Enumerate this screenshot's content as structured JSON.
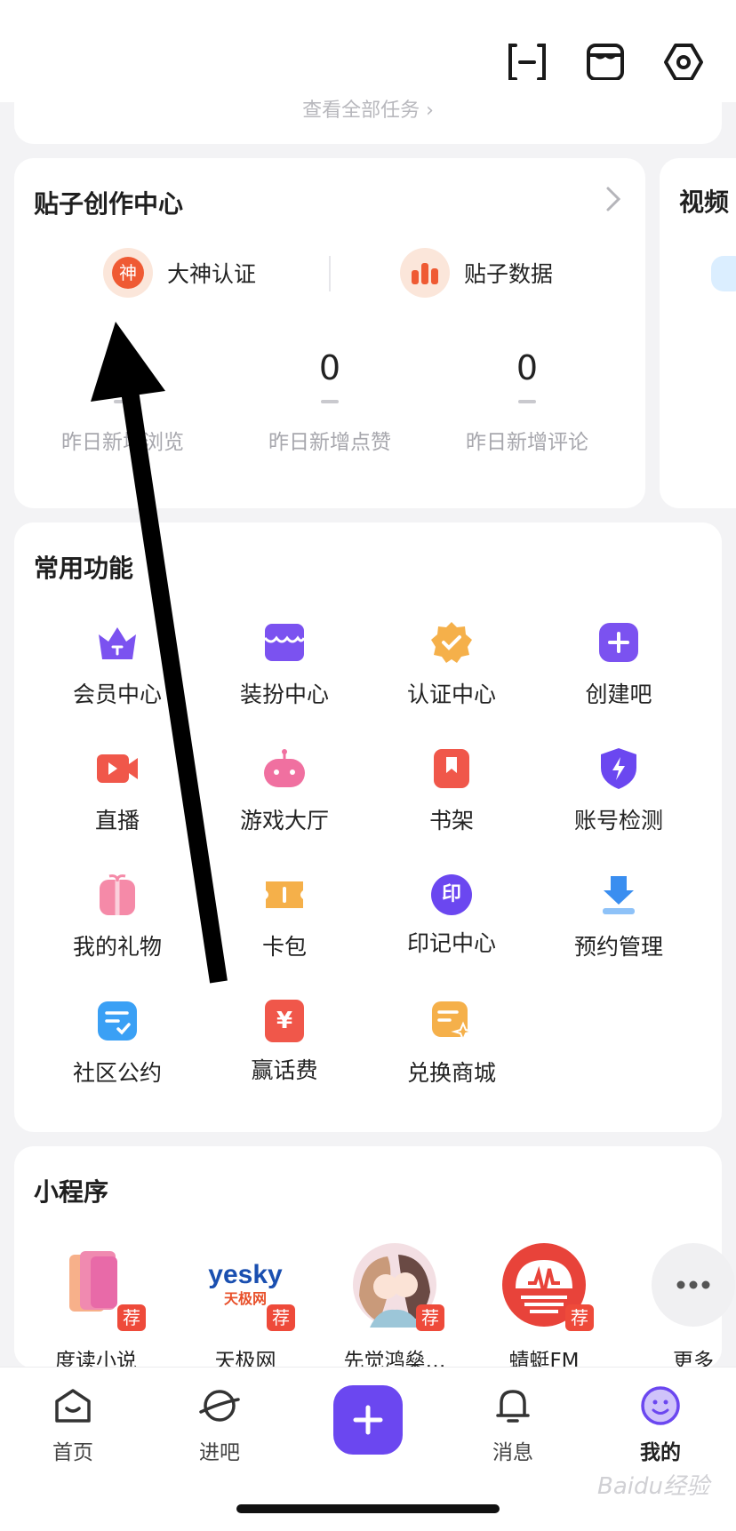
{
  "top_actions": {
    "icons": [
      "scan-icon",
      "shop-box-icon",
      "settings-hex-icon"
    ]
  },
  "tasks_card": {
    "view_all_label": "查看全部任务"
  },
  "creator_center": {
    "title": "贴子创作中心",
    "actions": [
      {
        "icon": "god-badge-icon",
        "badge_text": "神",
        "label": "大神认证"
      },
      {
        "icon": "bar-chart-icon",
        "label": "贴子数据"
      }
    ],
    "stats": [
      {
        "value": "",
        "label": "昨日新增浏览"
      },
      {
        "value": "0",
        "label": "昨日新增点赞"
      },
      {
        "value": "0",
        "label": "昨日新增评论"
      }
    ]
  },
  "video_card": {
    "title": "视频"
  },
  "common_functions": {
    "title": "常用功能",
    "items": [
      {
        "label": "会员中心",
        "icon": "crown-icon",
        "color": "#7b52f0"
      },
      {
        "label": "装扮中心",
        "icon": "wardrobe-icon",
        "color": "#7b52f0"
      },
      {
        "label": "认证中心",
        "icon": "verified-badge-icon",
        "color": "#f5b04a"
      },
      {
        "label": "创建吧",
        "icon": "plus-square-icon",
        "color": "#7b52f0"
      },
      {
        "label": "直播",
        "icon": "video-camera-icon",
        "color": "#f0574a"
      },
      {
        "label": "游戏大厅",
        "icon": "game-controller-icon",
        "color": "#f070a0"
      },
      {
        "label": "书架",
        "icon": "bookmark-book-icon",
        "color": "#f0574a"
      },
      {
        "label": "账号检测",
        "icon": "shield-bolt-icon",
        "color": "#6b47f0"
      },
      {
        "label": "我的礼物",
        "icon": "gift-icon",
        "color": "#f58aa8"
      },
      {
        "label": "卡包",
        "icon": "ticket-icon",
        "color": "#f5b04a"
      },
      {
        "label": "印记中心",
        "icon": "seal-icon",
        "color": "#6b47f0",
        "glyph": "印"
      },
      {
        "label": "预约管理",
        "icon": "download-tray-icon",
        "color": "#3a8ef0"
      },
      {
        "label": "社区公约",
        "icon": "checklist-icon",
        "color": "#3aa0f5"
      },
      {
        "label": "赢话费",
        "icon": "yuan-box-icon",
        "color": "#f0574a",
        "glyph": "¥"
      },
      {
        "label": "兑换商城",
        "icon": "exchange-store-icon",
        "color": "#f5b04a"
      }
    ]
  },
  "mini_programs": {
    "title": "小程序",
    "badge": "荐",
    "items": [
      {
        "label": "度读小说",
        "icon": "book-app-icon"
      },
      {
        "label": "天极网",
        "icon": "yesky-logo-icon",
        "logo_text": "yesky",
        "logo_sub": "天极网"
      },
      {
        "label": "先觉鸿燊…",
        "icon": "couple-avatar-icon"
      },
      {
        "label": "蜻蜓FM",
        "icon": "radio-app-icon"
      },
      {
        "label": "更多",
        "icon": "more-dots-icon"
      }
    ]
  },
  "tabbar": {
    "tabs": [
      {
        "label": "首页",
        "icon": "home-icon"
      },
      {
        "label": "进吧",
        "icon": "planet-icon"
      },
      {
        "label": "",
        "icon": "plus-icon"
      },
      {
        "label": "消息",
        "icon": "bell-icon"
      },
      {
        "label": "我的",
        "icon": "smiley-avatar-icon",
        "active": true
      }
    ]
  },
  "watermark": "Baidu经验",
  "colors": {
    "accent": "#6b47f0",
    "card": "#ffffff",
    "bg": "#f3f3f5"
  }
}
